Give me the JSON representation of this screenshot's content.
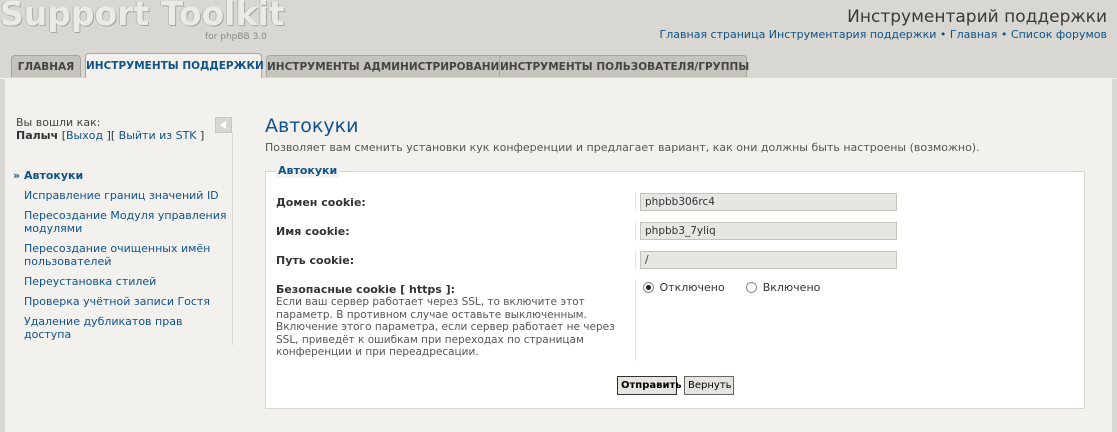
{
  "header": {
    "logo_text": "Support Toolkit",
    "logo_sub": "for phpBB 3.0",
    "site_title": "Инструментарий поддержки",
    "links": [
      "Главная страница Инструментария поддержки",
      "Главная",
      "Список форумов"
    ],
    "separator": "•"
  },
  "tabs": [
    {
      "label": "ГЛАВНАЯ"
    },
    {
      "label": "ИНСТРУМЕНТЫ ПОДДЕРЖКИ"
    },
    {
      "label": "ИНСТРУМЕНТЫ АДМИНИСТРИРОВАНИЯ"
    },
    {
      "label": "ИНСТРУМЕНТЫ ПОЛЬЗОВАТЕЛЯ/ГРУППЫ"
    }
  ],
  "active_tab": "ИНСТРУМЕНТЫ ПОДДЕРЖКИ",
  "sidebar": {
    "logged_in_label": "Вы вошли как:",
    "username": "Палыч",
    "logout_link": "Выход",
    "exit_stk_link": "Выйти из STK",
    "bracket_open": "[",
    "bracket_mid": "][",
    "bracket_close": "]",
    "menu": [
      "Автокуки",
      "Исправление границ значений ID",
      "Пересоздание Модуля управления модулями",
      "Пересоздание очищенных имён пользователей",
      "Переустановка стилей",
      "Проверка учётной записи Гостя",
      "Удаление дубликатов прав доступа"
    ],
    "active_item": "Автокуки"
  },
  "main": {
    "title": "Автокуки",
    "description": "Позволяет вам сменить установки кук конференции и предлагает вариант, как они должны быть настроены (возможно).",
    "fieldset_legend": "Автокуки",
    "fields": {
      "domain_label": "Домен cookie:",
      "domain_value": "phpbb306rc4",
      "name_label": "Имя cookie:",
      "name_value": "phpbb3_7yliq",
      "path_label": "Путь cookie:",
      "path_value": "/",
      "secure_label": "Безопасные cookie [ https ]:",
      "secure_help": "Если ваш сервер работает через SSL, то включите этот параметр. В противном случае оставьте выключенным. Включение этого параметра, если сервер работает не через SSL, приведёт к ошибкам при переходах по страницам конференции и при переадресации.",
      "radio_off": "Отключено",
      "radio_on": "Включено",
      "secure_selected": "Отключено"
    },
    "submit_label": "Отправить",
    "reset_label": "Вернуть"
  },
  "colors": {
    "link": "#105289",
    "page_bg": "#d9d7d1",
    "panel_bg": "#f2f1ee"
  }
}
